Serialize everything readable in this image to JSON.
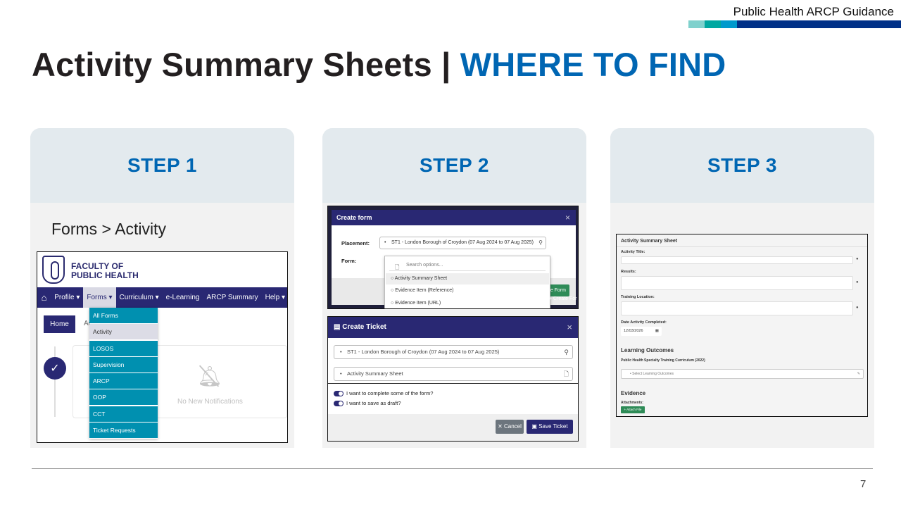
{
  "header": {
    "label": "Public Health ARCP Guidance",
    "bar_colors": [
      "#7fd1cd",
      "#00a7a0",
      "#0099cc",
      "#003087"
    ]
  },
  "title": {
    "main": "Activity Summary Sheets | ",
    "accent": "WHERE TO FIND"
  },
  "colors": {
    "accent": "#0066b3",
    "navy": "#292873",
    "teal": "#0090b0"
  },
  "steps": [
    {
      "heading": "STEP 1",
      "caption": "Forms > Activity",
      "screenshot": {
        "logo_text": "FACULTY OF PUBLIC HEALTH",
        "nav": {
          "home_icon": "home-icon",
          "items": [
            "Profile ▾",
            "Forms ▾",
            "Curriculum ▾",
            "e-Learning",
            "ARCP Summary",
            "Help ▾"
          ]
        },
        "home_button": "Home",
        "breadcrumb_rest": "Ac",
        "dropdown": [
          "All Forms",
          "Activity",
          "LOSOS",
          "Supervision",
          "ARCP",
          "OOP",
          "CCT",
          "Ticket Requests"
        ],
        "selected": "Activity",
        "notification_text": "No New Notifications",
        "check_icon": "check-icon",
        "bell_icon": "bell-off-icon"
      }
    },
    {
      "heading": "STEP 2",
      "create_form": {
        "title": "Create form",
        "close": "×",
        "placement_label": "Placement:",
        "placement_value": "ST1 - London Borough of Croydon (07 Aug 2024 to 07 Aug 2025)",
        "form_label": "Form:",
        "search_placeholder": "Search options...",
        "options": [
          "Activity Summary Sheet",
          "Evidence Item (Reference)",
          "Evidence Item (URL)"
        ],
        "create_button": "ate Form",
        "create_ghost": "+ Create For"
      },
      "create_ticket": {
        "title": "Create Ticket",
        "close": "×",
        "placement_value": "ST1 - London Borough of Croydon (07 Aug 2024 to 07 Aug 2025)",
        "form_value": "Activity Summary Sheet",
        "toggle_1": "I want to complete some of the form?",
        "toggle_2": "I want to save as draft?",
        "cancel": "✕ Cancel",
        "save": "Save Ticket"
      }
    },
    {
      "heading": "STEP 3",
      "form": {
        "title": "Activity Summary Sheet",
        "activity_title_label": "Activity Title:",
        "results_label": "Results:",
        "training_location_label": "Training Location:",
        "date_label": "Date Activity Completed:",
        "date_value": "12/03/2026",
        "learning_outcomes_heading": "Learning Outcomes",
        "curriculum_label": "Public Health Specialty Training Curriculum (2022)",
        "outcomes_placeholder": "Select Learning Outcomes",
        "evidence_heading": "Evidence",
        "attachments_label": "Attachments:",
        "attach_button": "+ Attach File"
      }
    }
  ],
  "page_number": "7"
}
